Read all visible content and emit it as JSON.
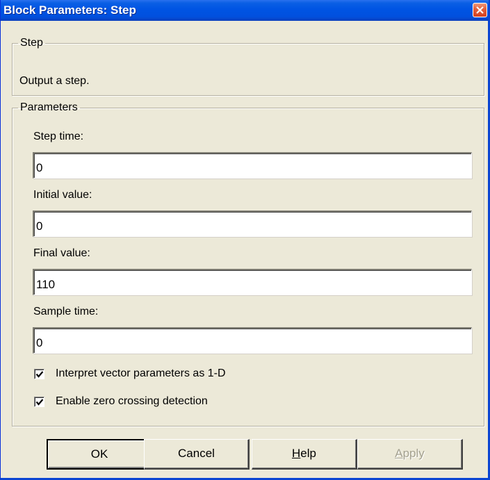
{
  "window": {
    "title": "Block Parameters: Step"
  },
  "description_group": {
    "legend": "Step",
    "text": "Output a step."
  },
  "parameters_group": {
    "legend": "Parameters",
    "fields": [
      {
        "label": "Step time:",
        "value": "0"
      },
      {
        "label": "Initial value:",
        "value": "0"
      },
      {
        "label": "Final value:",
        "value": "110"
      },
      {
        "label": "Sample time:",
        "value": "0"
      }
    ],
    "checkboxes": [
      {
        "label": "Interpret vector parameters as 1-D",
        "checked": true
      },
      {
        "label": "Enable zero crossing detection",
        "checked": true
      }
    ]
  },
  "buttons": {
    "ok": "OK",
    "cancel": "Cancel",
    "help_mnemonic": "H",
    "help_rest": "elp",
    "apply_mnemonic": "A",
    "apply_rest": "pply"
  },
  "colors": {
    "titlebar": "#0054e3",
    "dialog_bg": "#ece9d8",
    "disabled_text": "#a3a08e"
  }
}
